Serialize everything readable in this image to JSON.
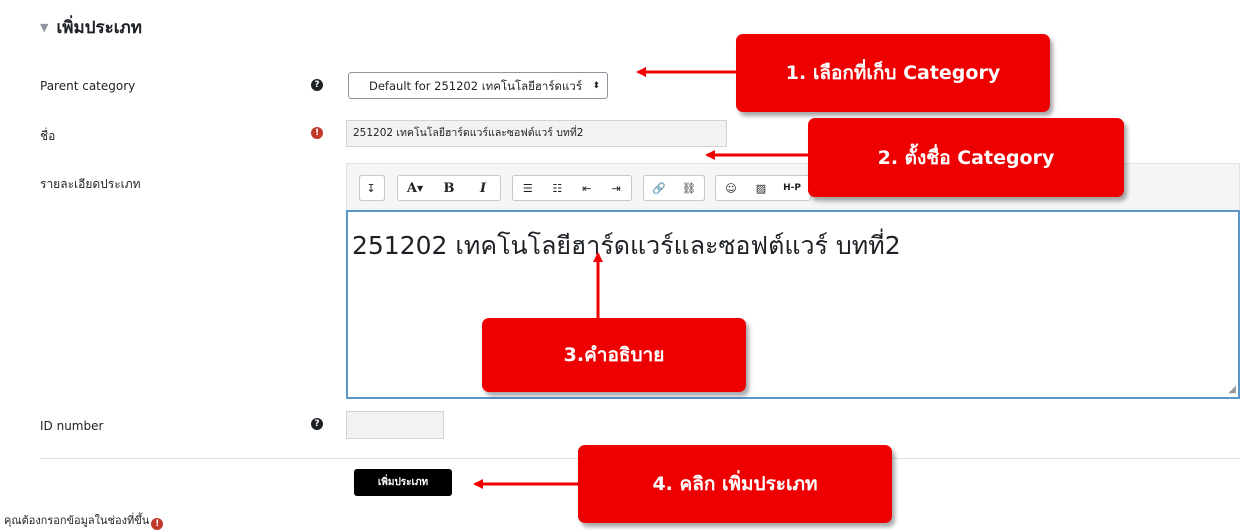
{
  "section": {
    "title": "เพิ่มประเภท",
    "collapse_icon": "chevron-down-icon"
  },
  "form": {
    "parent_category": {
      "label": "Parent category",
      "help_icon": "question-circle-icon",
      "selected": "Default for 251202 เทคโนโลยีฮาร์ดแวร์"
    },
    "name": {
      "label": "ชื่อ",
      "required_icon": "exclamation-circle-icon",
      "value": "251202 เทคโนโลยีฮาร์ดแวร์และซอฟต์แวร์ บทที่2"
    },
    "description": {
      "label": "รายละเอียดประเภท",
      "content": "251202 เทคโนโลยีฮาร์ดแวร์และซอฟต์แวร์ บทที่2",
      "toolbar": {
        "toggle_icon": "toolbar-toggle-icon",
        "font_color_label": "A",
        "bold_label": "B",
        "italic_label": "I",
        "unordered_list_icon": "unordered-list-icon",
        "ordered_list_icon": "ordered-list-icon",
        "outdent_icon": "outdent-icon",
        "indent_icon": "indent-icon",
        "link_icon": "link-icon",
        "unlink_icon": "unlink-icon",
        "emoji_icon": "emoji-icon",
        "image_icon": "image-icon",
        "h5p_label": "H-P"
      }
    },
    "id_number": {
      "label": "ID number",
      "help_icon": "question-circle-icon",
      "value": ""
    },
    "submit_label": "เพิ่มประเภท",
    "required_note": "คุณต้องกรอกข้อมูลในช่องที่ขึ้น"
  },
  "annotations": [
    {
      "text": "1. เลือกที่เก็บ Category"
    },
    {
      "text": "2. ตั้งชื่อ Category"
    },
    {
      "text": "3.คำอธิบาย"
    },
    {
      "text": "4. คลิก เพิ่มประเภท"
    }
  ],
  "colors": {
    "callout": "#ee0000",
    "editor_border": "#5b96c9",
    "button": "#000000"
  }
}
